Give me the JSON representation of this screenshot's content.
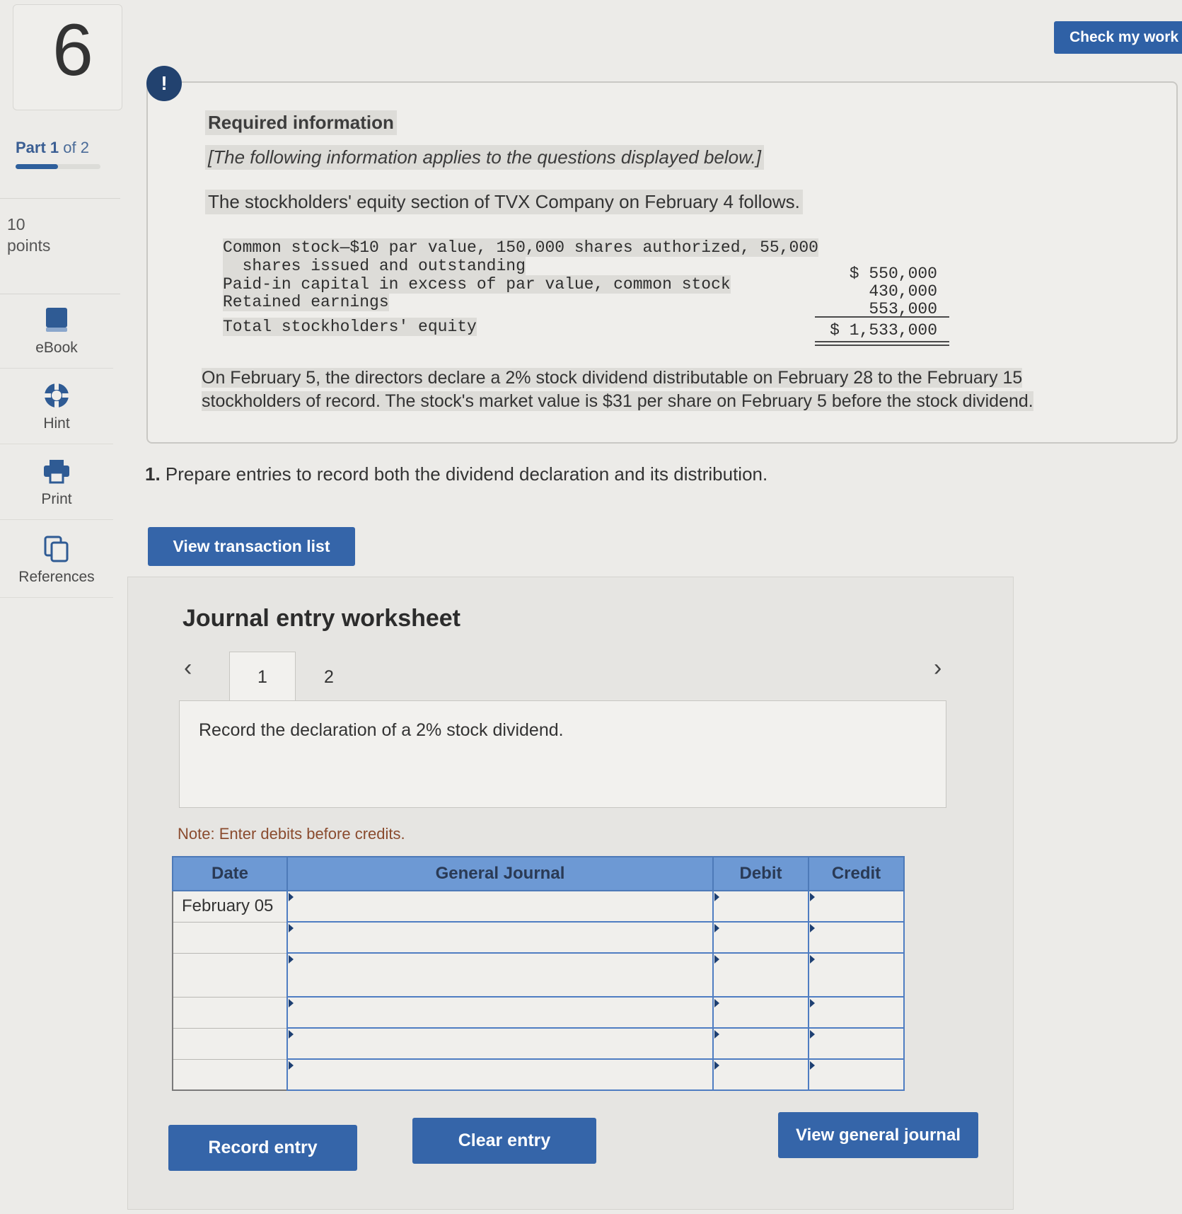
{
  "question": {
    "number": "6",
    "part": "Part",
    "part_current": "1",
    "part_of": "of",
    "part_total": "2",
    "part_progress": 0.5,
    "points": "10",
    "points_label": "points"
  },
  "rail": {
    "tools": [
      "eBook",
      "Hint",
      "Print",
      "References"
    ]
  },
  "header": {
    "check_button": "Check my work"
  },
  "required": {
    "alert": "!",
    "title": "Required information",
    "subtitle": "[The following information applies to the questions displayed below.]",
    "intro": "The stockholders' equity section of TVX Company on February 4 follows.",
    "equity": {
      "lines": [
        {
          "label": "Common stock—$10 par value, 150,000 shares authorized, 55,000",
          "amount": ""
        },
        {
          "label": "  shares issued and outstanding",
          "amount": "$ 550,000"
        },
        {
          "label": "Paid-in capital in excess of par value, common stock",
          "amount": "430,000"
        },
        {
          "label": "Retained earnings",
          "amount": "553,000"
        },
        {
          "label": "Total stockholders' equity",
          "amount": "$ 1,533,000"
        }
      ]
    },
    "dividend_line1": "On February 5, the directors declare a 2% stock dividend distributable on February 28 to the February 15",
    "dividend_line2": "stockholders of record. The stock's market value is $31 per share on February 5 before the stock dividend."
  },
  "task": {
    "number": "1.",
    "text": "Prepare entries to record both the dividend declaration and its distribution."
  },
  "buttons": {
    "view_transactions": "View transaction list",
    "record": "Record entry",
    "clear": "Clear entry",
    "view_journal": "View general journal"
  },
  "worksheet": {
    "title": "Journal entry worksheet",
    "tabs": [
      "1",
      "2"
    ],
    "instruction": "Record the declaration of a 2% stock dividend.",
    "note": "Note: Enter debits before credits.",
    "columns": [
      "Date",
      "General Journal",
      "Debit",
      "Credit"
    ],
    "rows": [
      {
        "date": "February 05",
        "account": "",
        "debit": "",
        "credit": ""
      },
      {
        "date": "",
        "account": "",
        "debit": "",
        "credit": ""
      },
      {
        "date": "",
        "account": "",
        "debit": "",
        "credit": ""
      },
      {
        "date": "",
        "account": "",
        "debit": "",
        "credit": ""
      },
      {
        "date": "",
        "account": "",
        "debit": "",
        "credit": ""
      },
      {
        "date": "",
        "account": "",
        "debit": "",
        "credit": ""
      }
    ]
  }
}
